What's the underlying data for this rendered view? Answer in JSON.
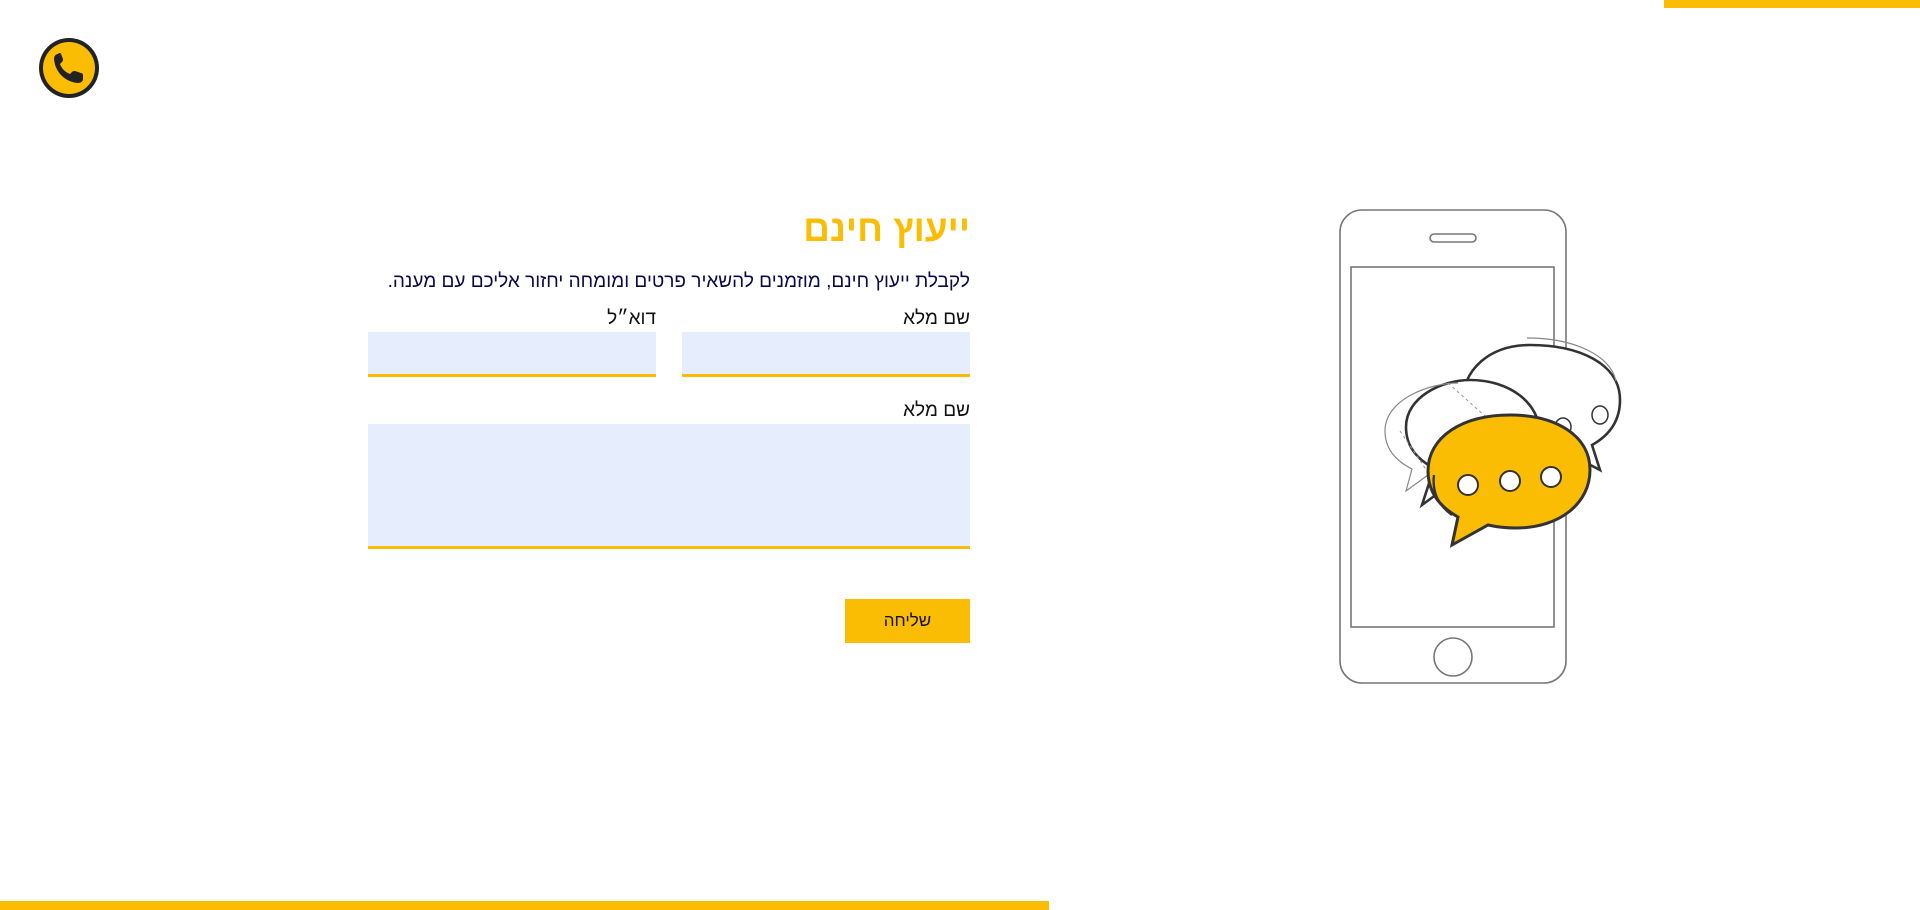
{
  "colors": {
    "accent": "#fbbc04",
    "input_background": "#e6eefd",
    "intro_text": "#0a0a4a",
    "logo_dark": "#222222"
  },
  "header": {
    "logo_icon": "phone-icon"
  },
  "form": {
    "title": "ייעוץ חינם",
    "intro": "לקבלת ייעוץ חינם, מוזמנים להשאיר פרטים ומומחה יחזור אליכם עם מענה.",
    "fields": {
      "full_name": {
        "label": "שם מלא",
        "value": ""
      },
      "email": {
        "label": "דוא״ל",
        "value": ""
      },
      "message": {
        "label": "שם מלא",
        "value": ""
      }
    },
    "submit_label": "שליחה"
  },
  "illustration": {
    "icon": "phone-chat-bubbles-illustration"
  }
}
